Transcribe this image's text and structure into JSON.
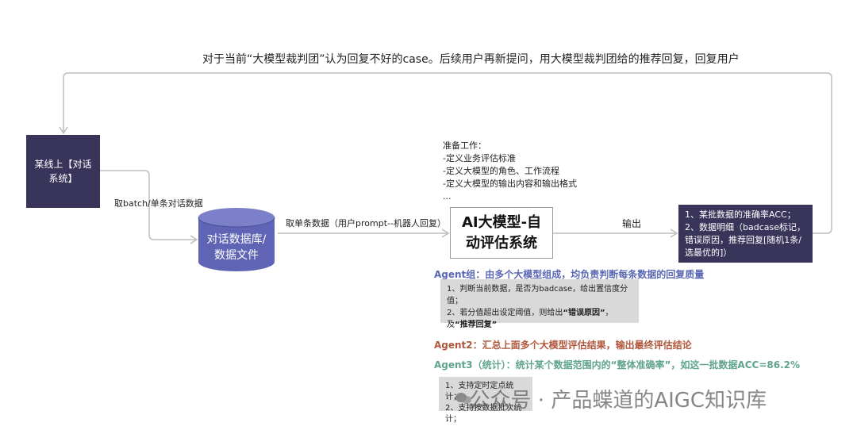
{
  "feedback_caption": "对于当前“大模型裁判团”认为回复不好的case。后续用户再新提问，用大模型裁判团给的推荐回复，回复用户",
  "online_system": "某线上【对话系统】",
  "fetch_label": "取batch/单条对话数据",
  "database": {
    "line1": "对话数据库/",
    "line2": "数据文件"
  },
  "single_label": "取单条数据（用户prompt--机器人回复）",
  "prep": {
    "title": "准备工作：",
    "items": [
      "-定义业务评估标准",
      "-定义大模型的角色、工作流程",
      "-定义大模型的输出内容和输出格式",
      "..."
    ]
  },
  "ai_system": "AI大模型-自动评估系统",
  "output_label": "输出",
  "output": {
    "line1": "1、某批数据的准确率ACC；",
    "line2": "2、数据明细（badcase标记，错误原因，推荐回复[随机1条/选最优的]）"
  },
  "agent1": {
    "title": "Agent组：由多个大模型组成，均负责判断每条数据的回复质量",
    "line1": "1、判断当前数据，是否为badcase，给出置信度分值；",
    "line2_prefix": "2、若分值超出设定阈值，则给出",
    "line2_b1": "“错误原因”",
    "line2_mid": "，及",
    "line2_b2": "“推荐回复”"
  },
  "agent2": "Agent2：汇总上面多个大模型评估结果，输出最终评估结论",
  "agent3": {
    "title": "Agent3（统计）：统计某个数据范围内的“整体准确率”，如这一批数据ACC=86.2%",
    "line1": "1、支持定时定点统计；",
    "line2": "2、支持按数据批次统计；"
  },
  "watermark": "公众号 · 产品蝶道的AIGC知识库",
  "colors": {
    "dark_box": "#38345a",
    "database": "#5f64b5",
    "agent1": "#5a67b3",
    "agent2": "#b0573c",
    "agent3": "#5fa48a"
  }
}
